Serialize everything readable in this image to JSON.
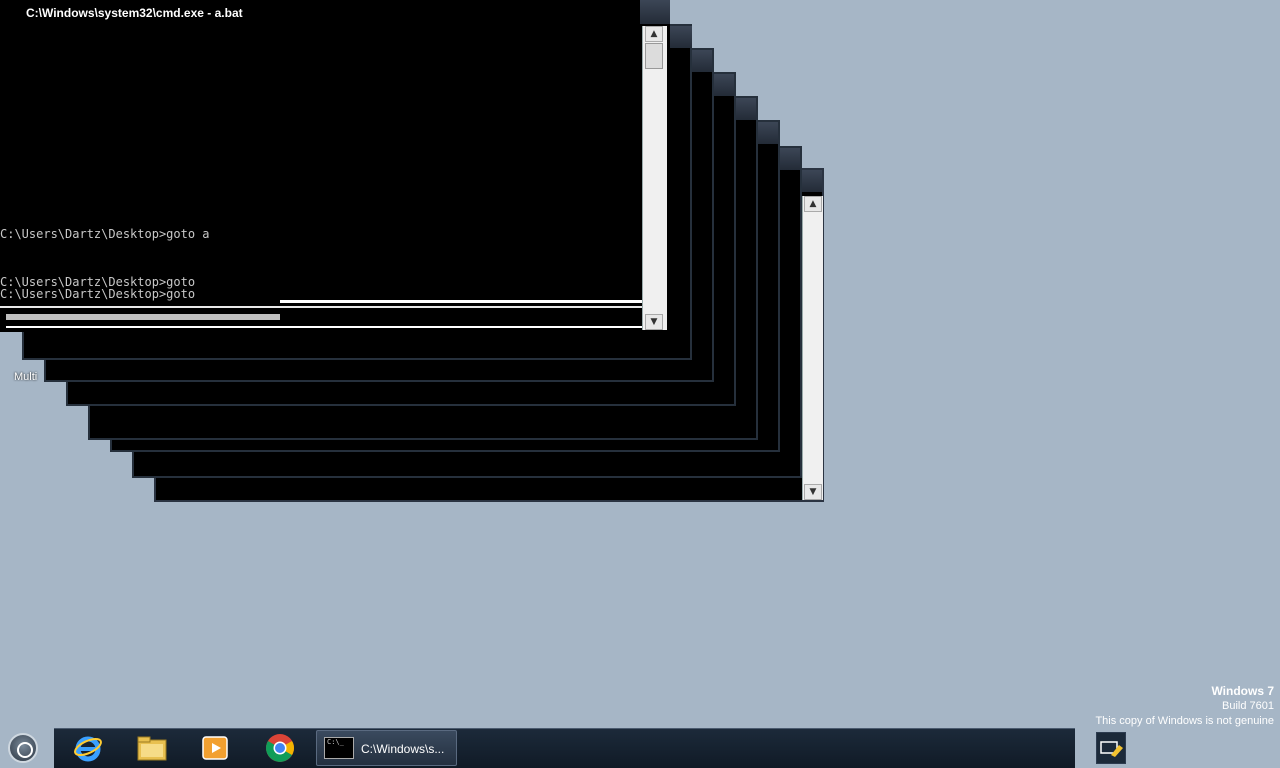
{
  "console": {
    "title": "C:\\Windows\\system32\\cmd.exe - a.bat",
    "line1": "C:\\Users\\Dartz\\Desktop>goto a",
    "line2": "C:\\Users\\Dartz\\Desktop>goto",
    "line3": "C:\\Users\\Dartz\\Desktop>goto",
    "scroll_up": "▲",
    "scroll_down": "▼"
  },
  "desktop": {
    "partial_label": "Multi"
  },
  "watermark": {
    "title": "Windows 7",
    "build": "Build 7601",
    "notice": "This copy of Windows is not genuine"
  },
  "taskbar": {
    "start": "start-orb-icon",
    "pinned": [
      "internet-explorer-icon",
      "file-explorer-icon",
      "media-player-icon",
      "chrome-icon"
    ],
    "task_label": "C:\\Windows\\s...",
    "task_icon_text": "C:\\_"
  },
  "colors": {
    "desktop": "#a6b6c6",
    "taskbar": "#16222f",
    "console_bg": "#000000",
    "console_text": "#c8c8c8"
  }
}
